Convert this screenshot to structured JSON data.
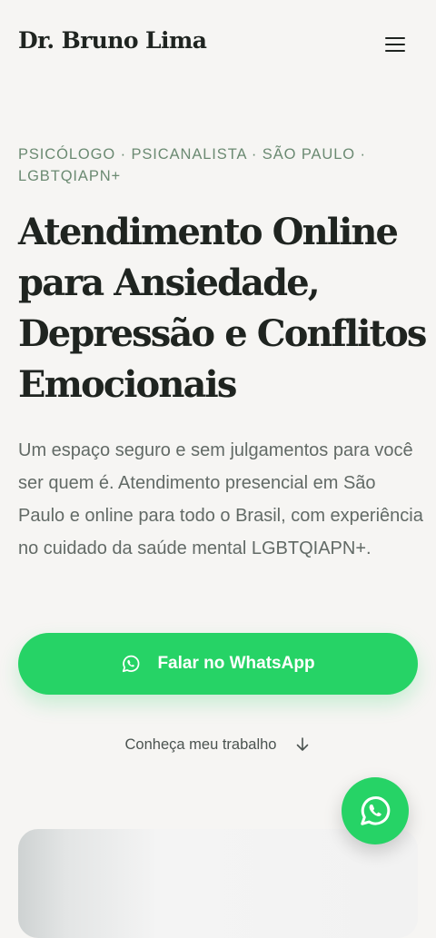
{
  "header": {
    "brand": "Dr. Bruno Lima",
    "menu_icon": "hamburger-menu-icon"
  },
  "hero": {
    "eyebrow": "PSICÓLOGO · PSICANALISTA · SÃO PAULO · LGBTQIAPN+",
    "headline": "Atendimento Online para Ansiedade, Depressão e Conflitos Emocionais",
    "lead": "Um espaço seguro e sem julgamentos para você ser quem é. Atendimento presencial em São Paulo e online para todo o Brasil, com experiência no cuidado da saúde mental LGBTQIAPN+.",
    "cta_label": "Falar no WhatsApp",
    "cta_icon": "whatsapp-icon",
    "secondary_label": "Conheça meu trabalho",
    "secondary_icon": "arrow-down-icon"
  },
  "floating": {
    "icon": "whatsapp-icon"
  },
  "colors": {
    "background": "#f6f5f3",
    "accent_green": "#26d366",
    "eyebrow_green": "#6b8a72",
    "heading": "#1f2420",
    "body_text": "#626a66"
  }
}
